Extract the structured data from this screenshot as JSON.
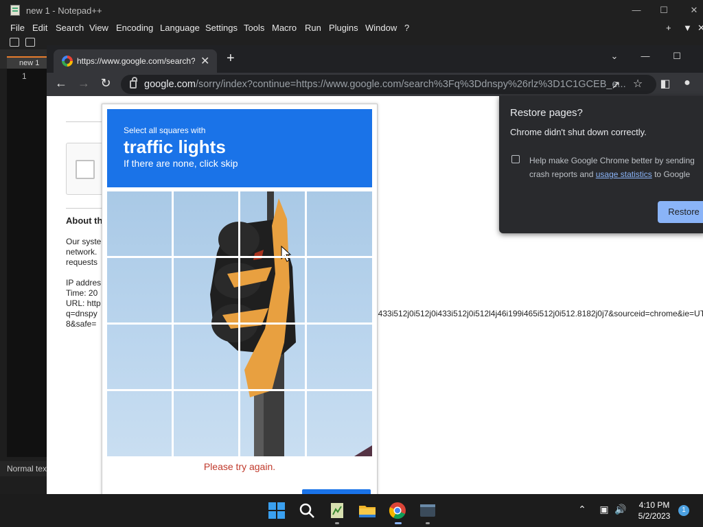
{
  "notepad": {
    "title": "new 1 - Notepad++",
    "menu": [
      "File",
      "Edit",
      "Search",
      "View",
      "Encoding",
      "Language",
      "Settings",
      "Tools",
      "Macro",
      "Run",
      "Plugins",
      "Window",
      "?"
    ],
    "tab_label": "new 1",
    "line_number": "1",
    "status_text": "Normal text file"
  },
  "chrome": {
    "tab_title": "https://www.google.com/search?",
    "new_tab": "+",
    "url_host": "google.com",
    "url_rest": "/sorry/index?continue=https://www.google.com/search%3Fq%3Ddnspy%26rlz%3D1C1GCEB_e..."
  },
  "page": {
    "about_title": "About th",
    "lines": [
      "Our syste",
      "network.",
      "requests",
      "",
      "IP addres",
      "Time: 20",
      "URL: http",
      "q=dnspy",
      "8&safe="
    ],
    "url_tail": "i433i512j0i512j0i433i512j0i512l4j46i199i465i512j0i512.8182j0j7&sourceid=chrome&ie=UTF-"
  },
  "captcha": {
    "instruction_small": "Select all squares with",
    "instruction_big": "traffic lights",
    "instruction_skip": "If there are none, click skip",
    "error": "Please try again.",
    "grid_cols": 4,
    "grid_rows": 4
  },
  "restore": {
    "title": "Restore pages?",
    "message": "Chrome didn't shut down correctly.",
    "checkbox_text_before": "Help make Google Chrome better by sending crash reports and ",
    "checkbox_link": "usage statistics",
    "checkbox_text_after": " to Google",
    "button": "Restore"
  },
  "taskbar": {
    "time": "4:10 PM",
    "date": "5/2/2023",
    "notification_count": "1",
    "apps": [
      "start-icon",
      "search-icon",
      "notepadpp-icon",
      "file-explorer-icon",
      "chrome-icon",
      "terminal-icon"
    ]
  },
  "colors": {
    "captcha_blue": "#1a73e8",
    "error_red": "#c0392b",
    "restore_button": "#8ab4f8"
  }
}
